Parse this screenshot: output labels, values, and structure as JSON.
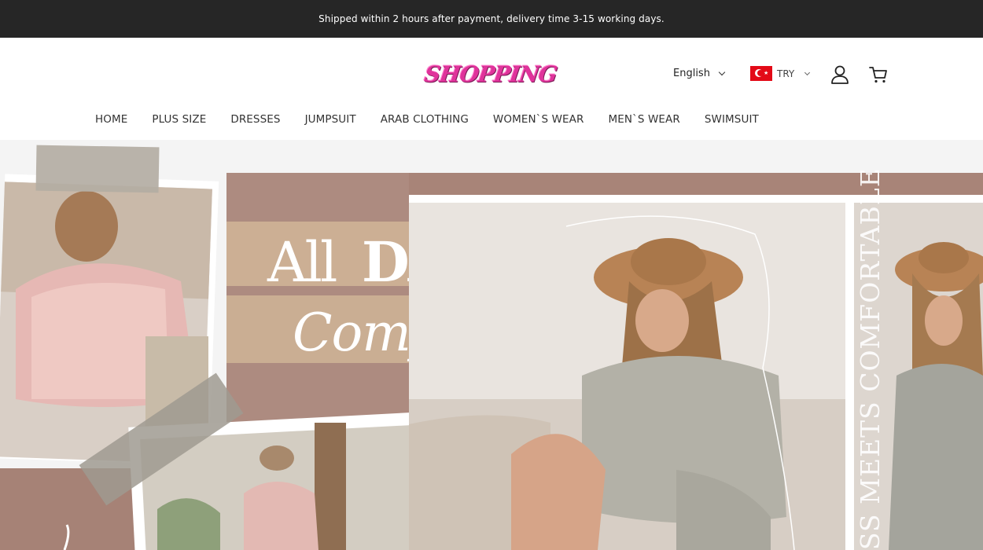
{
  "announcement": "Shipped within 2 hours after payment, delivery time 3-15 working days.",
  "header": {
    "logo": "SHOPPING",
    "language": "English",
    "currency": "TRY"
  },
  "nav": {
    "items": [
      "HOME",
      "PLUS SIZE",
      "DRESSES",
      "JUMPSUIT",
      "ARAB CLOTHING",
      "WOMEN`S WEAR",
      "MEN`S WEAR",
      "SWIMSUIT"
    ]
  },
  "hero": {
    "headline_line1_a": "All",
    "headline_line1_b": "DAY",
    "headline_line2": "Comfort",
    "side_text": "SS MEETS COMFORTABLE"
  },
  "colors": {
    "announce_bg": "#262626",
    "logo": "#e0339b",
    "flag": "#e30a17",
    "hero_mauve": "#a88478"
  }
}
